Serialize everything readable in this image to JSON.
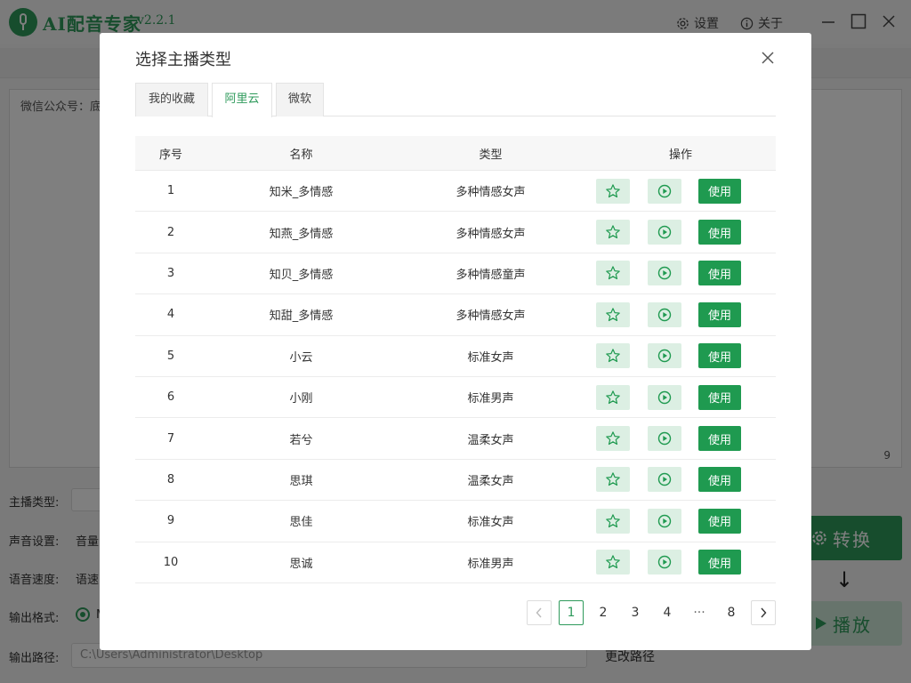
{
  "app": {
    "title": "AI配音专家",
    "version": "v2.2.1",
    "settings_label": "设置",
    "about_label": "关于"
  },
  "editor": {
    "content": "微信公众号：底",
    "char_count": "9"
  },
  "form": {
    "type_label": "主播类型:",
    "voice_label": "声音设置:",
    "volume_label": "音量",
    "speed_row_label": "语音速度:",
    "speed_label": "语速",
    "format_label": "输出格式:",
    "format_selected": "M",
    "path_label": "输出路径:",
    "path_value": "C:\\Users\\Administrator\\Desktop",
    "change_path_label": "更改路径"
  },
  "actions": {
    "convert_label": "转换",
    "play_label": "播放"
  },
  "dialog": {
    "title": "选择主播类型",
    "tabs": [
      {
        "label": "我的收藏"
      },
      {
        "label": "阿里云"
      },
      {
        "label": "微软"
      }
    ],
    "active_tab": "阿里云",
    "columns": {
      "index": "序号",
      "name": "名称",
      "type": "类型",
      "ops": "操作"
    },
    "use_label": "使用",
    "rows": [
      {
        "index": "1",
        "name": "知米_多情感",
        "type": "多种情感女声"
      },
      {
        "index": "2",
        "name": "知燕_多情感",
        "type": "多种情感女声"
      },
      {
        "index": "3",
        "name": "知贝_多情感",
        "type": "多种情感童声"
      },
      {
        "index": "4",
        "name": "知甜_多情感",
        "type": "多种情感女声"
      },
      {
        "index": "5",
        "name": "小云",
        "type": "标准女声"
      },
      {
        "index": "6",
        "name": "小刚",
        "type": "标准男声"
      },
      {
        "index": "7",
        "name": "若兮",
        "type": "温柔女声"
      },
      {
        "index": "8",
        "name": "思琪",
        "type": "温柔女声"
      },
      {
        "index": "9",
        "name": "思佳",
        "type": "标准女声"
      },
      {
        "index": "10",
        "name": "思诚",
        "type": "标准男声"
      }
    ],
    "pagination": {
      "current": "1",
      "pages": [
        "1",
        "2",
        "3",
        "4",
        "8"
      ],
      "ellipsis": "···"
    }
  },
  "colors": {
    "accent": "#2e9a5b",
    "use_button": "#1f9a50",
    "icon_button_bg": "#dcefe3"
  }
}
